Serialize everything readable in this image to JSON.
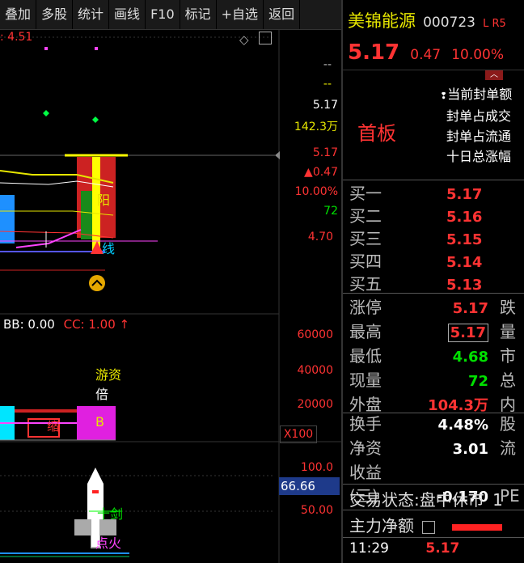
{
  "toolbar": {
    "items": [
      "叠加",
      "多股",
      "统计",
      "画线",
      "F10",
      "标记",
      "+自选",
      "返回"
    ]
  },
  "chart": {
    "top_indicator": ": 4.51",
    "right_labels": {
      "dash1": "--",
      "dash2": "--",
      "price": "5.17",
      "volume": "142.3万",
      "price2": "5.17",
      "change": "▲0.47",
      "change_pct": "10.00%",
      "value72": "72",
      "low_price": "4.70"
    },
    "indicator_bar": {
      "bb": "BB: 0.00",
      "cc": "CC: 1.00"
    },
    "vol_axis": [
      "60000",
      "40000",
      "20000"
    ],
    "vol_unit": "X100",
    "labels": {
      "youzi": "游资",
      "bei": "倍",
      "b": "B",
      "suo": "缩",
      "yang": "阳",
      "line": "线",
      "sword": "十剑",
      "fire": "点火"
    },
    "bottom_axis": [
      "100.0",
      "66.66",
      "50.00"
    ]
  },
  "panel": {
    "name": "美锦能源",
    "code": "000723",
    "tag": "L R5",
    "price": "5.17",
    "change": "0.47",
    "change_pct": "10.00%",
    "board": "首板",
    "seal_lines": [
      "当前封单额",
      "封单占成交",
      "封单占流通",
      "十日总涨幅"
    ],
    "bids": [
      {
        "label": "买一",
        "price": "5.17"
      },
      {
        "label": "买二",
        "price": "5.16"
      },
      {
        "label": "买三",
        "price": "5.15"
      },
      {
        "label": "买四",
        "price": "5.14"
      },
      {
        "label": "买五",
        "price": "5.13"
      }
    ],
    "stats": [
      {
        "label": "涨停",
        "value": "5.17",
        "right": "跌"
      },
      {
        "label": "最高",
        "value": "5.17",
        "right": "量"
      },
      {
        "label": "最低",
        "value": "4.68",
        "right": "市"
      },
      {
        "label": "现量",
        "value": "72",
        "right": "总"
      },
      {
        "label": "外盘",
        "value": "104.3万",
        "right": "内"
      }
    ],
    "stats2": [
      {
        "label": "换手",
        "value": "4.48%",
        "right": "股"
      },
      {
        "label": "净资",
        "value": "3.01",
        "right": "流"
      },
      {
        "label": "收益(三)",
        "value": "-0.170",
        "right": "PE"
      }
    ],
    "status_label": "交易状态:",
    "status_value": "盘中休市",
    "status_extra": "1",
    "main_net": "主力净额",
    "time": "11:29",
    "last_price": "5.17"
  }
}
